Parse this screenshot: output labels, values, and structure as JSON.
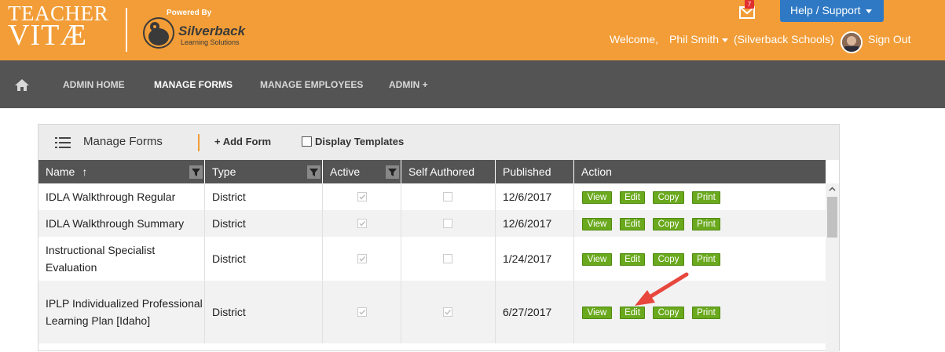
{
  "brand": {
    "logo_line1": "TEACHER",
    "logo_line2": "VITÆ",
    "powered_by": "Powered By",
    "partner_name": "Silverback",
    "partner_sub": "Learning Solutions"
  },
  "header": {
    "notification_count": "7",
    "help_label": "Help / Support",
    "welcome": "Welcome,",
    "user_name": "Phil Smith",
    "school": "(Silverback Schools)",
    "sign_out": "Sign Out",
    "accent_color": "#f29d37"
  },
  "nav": {
    "home_icon": "home-icon",
    "items": [
      {
        "label": "ADMIN HOME"
      },
      {
        "label": "MANAGE FORMS"
      },
      {
        "label": "MANAGE EMPLOYEES"
      },
      {
        "label": "ADMIN +"
      }
    ]
  },
  "panel": {
    "title": "Manage Forms",
    "add_form": "+ Add Form",
    "display_templates": "Display Templates",
    "display_templates_checked": false
  },
  "table": {
    "columns": [
      {
        "label": "Name",
        "sort": "↑",
        "filter": true
      },
      {
        "label": "Type",
        "filter": true
      },
      {
        "label": "Active",
        "filter": true
      },
      {
        "label": "Self Authored",
        "filter": false
      },
      {
        "label": "Published",
        "filter": false
      },
      {
        "label": "Action",
        "filter": false
      }
    ],
    "actions": [
      "View",
      "Edit",
      "Copy",
      "Print"
    ],
    "rows": [
      {
        "name": "IDLA Walkthrough Regular",
        "type": "District",
        "active": true,
        "self_authored": false,
        "published": "12/6/2017"
      },
      {
        "name": "IDLA Walkthrough Summary",
        "type": "District",
        "active": true,
        "self_authored": false,
        "published": "12/6/2017"
      },
      {
        "name": "Instructional Specialist Evaluation",
        "type": "District",
        "active": true,
        "self_authored": false,
        "published": "1/24/2017"
      },
      {
        "name": "IPLP Individualized Professional Learning Plan [Idaho]",
        "type": "District",
        "active": true,
        "self_authored": true,
        "published": "6/27/2017"
      }
    ]
  }
}
